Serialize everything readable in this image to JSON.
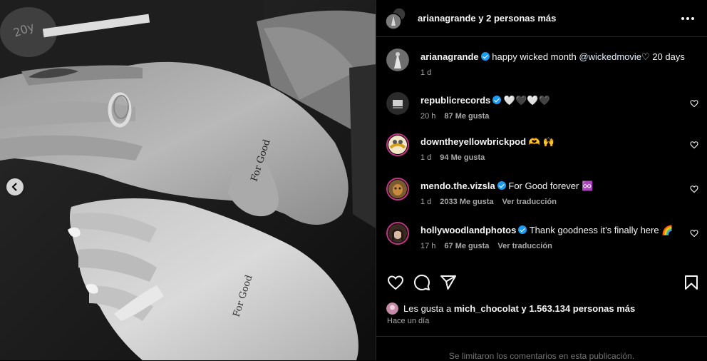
{
  "header": {
    "title": "arianagrande y 2 personas más"
  },
  "caption": {
    "user": "arianagrande",
    "text": "happy wicked month",
    "mention": "@wickedmovie",
    "suffix": "♡ 20 days",
    "time": "1 d"
  },
  "comments": [
    {
      "user": "republicrecords",
      "verified": true,
      "text": "🤍🖤🤍🖤",
      "time": "20 h",
      "likes": "87 Me gusta",
      "translate": ""
    },
    {
      "user": "downtheyellowbrickpod",
      "verified": false,
      "text": "🫶 🙌",
      "time": "1 d",
      "likes": "94 Me gusta",
      "translate": ""
    },
    {
      "user": "mendo.the.vizsla",
      "verified": true,
      "text": "For Good forever ♾️",
      "time": "1 d",
      "likes": "2033 Me gusta",
      "translate": "Ver traducción"
    },
    {
      "user": "hollywoodlandphotos",
      "verified": true,
      "text": "Thank goodness it’s finally here 🌈",
      "time": "17 h",
      "likes": "67 Me gusta",
      "translate": "Ver traducción"
    }
  ],
  "likes": {
    "prefix": "Les gusta a",
    "user": "mich_chocolat",
    "suffix": "y 1.563.134 personas más"
  },
  "posted": "Hace un día",
  "footer": "Se limitaron los comentarios en esta publicación.",
  "photo": {
    "tattoo_text": "For Good"
  },
  "icons": {
    "carousel_prev": "chevron-left-icon",
    "more": "more-horizontal-icon",
    "like": "heart-icon",
    "comment": "comment-icon",
    "share": "send-icon",
    "save": "bookmark-icon"
  },
  "colors": {
    "background": "#000000",
    "text": "#f5f5f5",
    "secondary": "#a8a8a8",
    "verified": "#1d9bf0",
    "divider": "#262626"
  }
}
